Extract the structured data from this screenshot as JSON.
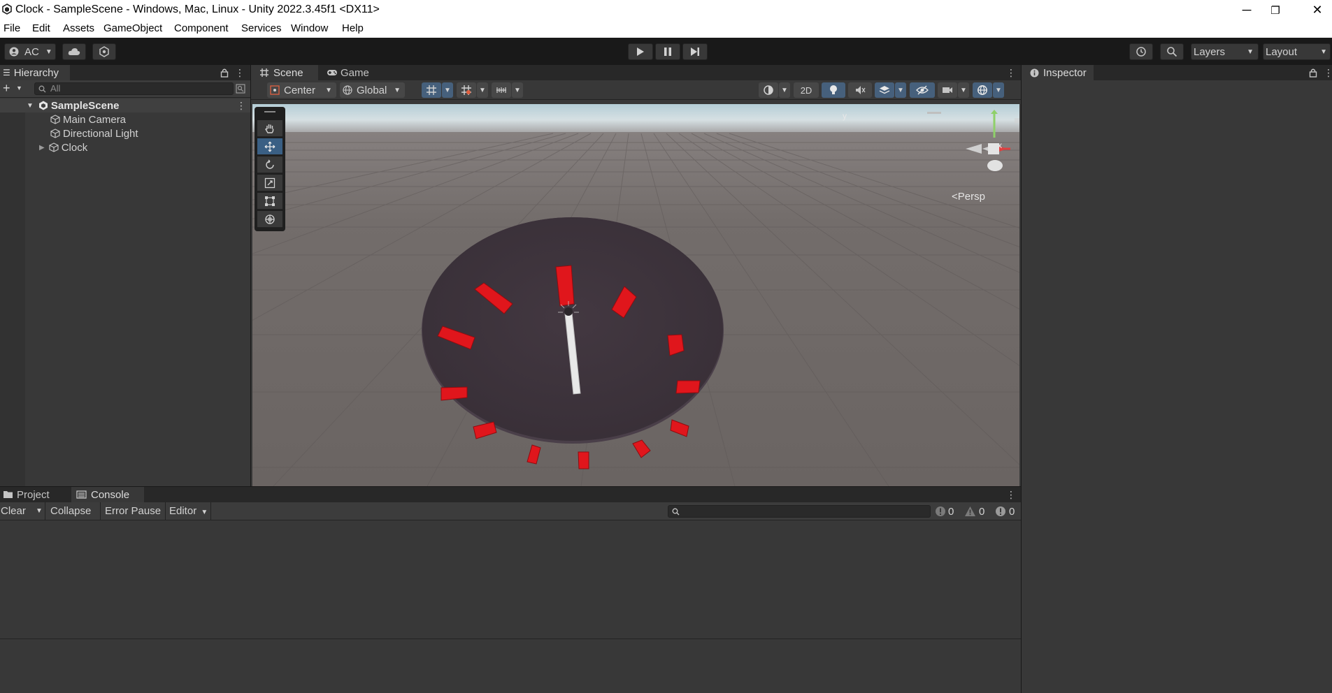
{
  "window": {
    "title": "Clock - SampleScene - Windows, Mac, Linux - Unity 2022.3.45f1 <DX11>",
    "minimize": "─",
    "restore": "❐",
    "close": "✕"
  },
  "menu": [
    "File",
    "Edit",
    "Assets",
    "GameObject",
    "Component",
    "Services",
    "Window",
    "Help"
  ],
  "toolbar": {
    "account": "AC",
    "layers": "Layers",
    "layout": "Layout"
  },
  "hierarchy": {
    "tab": "Hierarchy",
    "search_placeholder": "All",
    "scene": "SampleScene",
    "items": [
      "Main Camera",
      "Directional Light",
      "Clock"
    ]
  },
  "scene_view": {
    "tabs": [
      "Scene",
      "Game"
    ],
    "pivot": "Center",
    "space": "Global",
    "mode_2d": "2D",
    "gizmo": {
      "y": "y",
      "x": "x",
      "projection": "Persp"
    }
  },
  "inspector": {
    "tab": "Inspector"
  },
  "bottom": {
    "tabs": [
      "Project",
      "Console"
    ],
    "clear": "Clear",
    "collapse": "Collapse",
    "error_pause": "Error Pause",
    "editor": "Editor",
    "log_count": "0",
    "warning_count": "0",
    "error_count": "0"
  },
  "colors": {
    "accent_blue": "#3a5f84",
    "clock_face": "#3e3339",
    "hour_marker": "#e0161c",
    "clock_arm": "#e8e8e8",
    "ground": "#6f6866"
  }
}
